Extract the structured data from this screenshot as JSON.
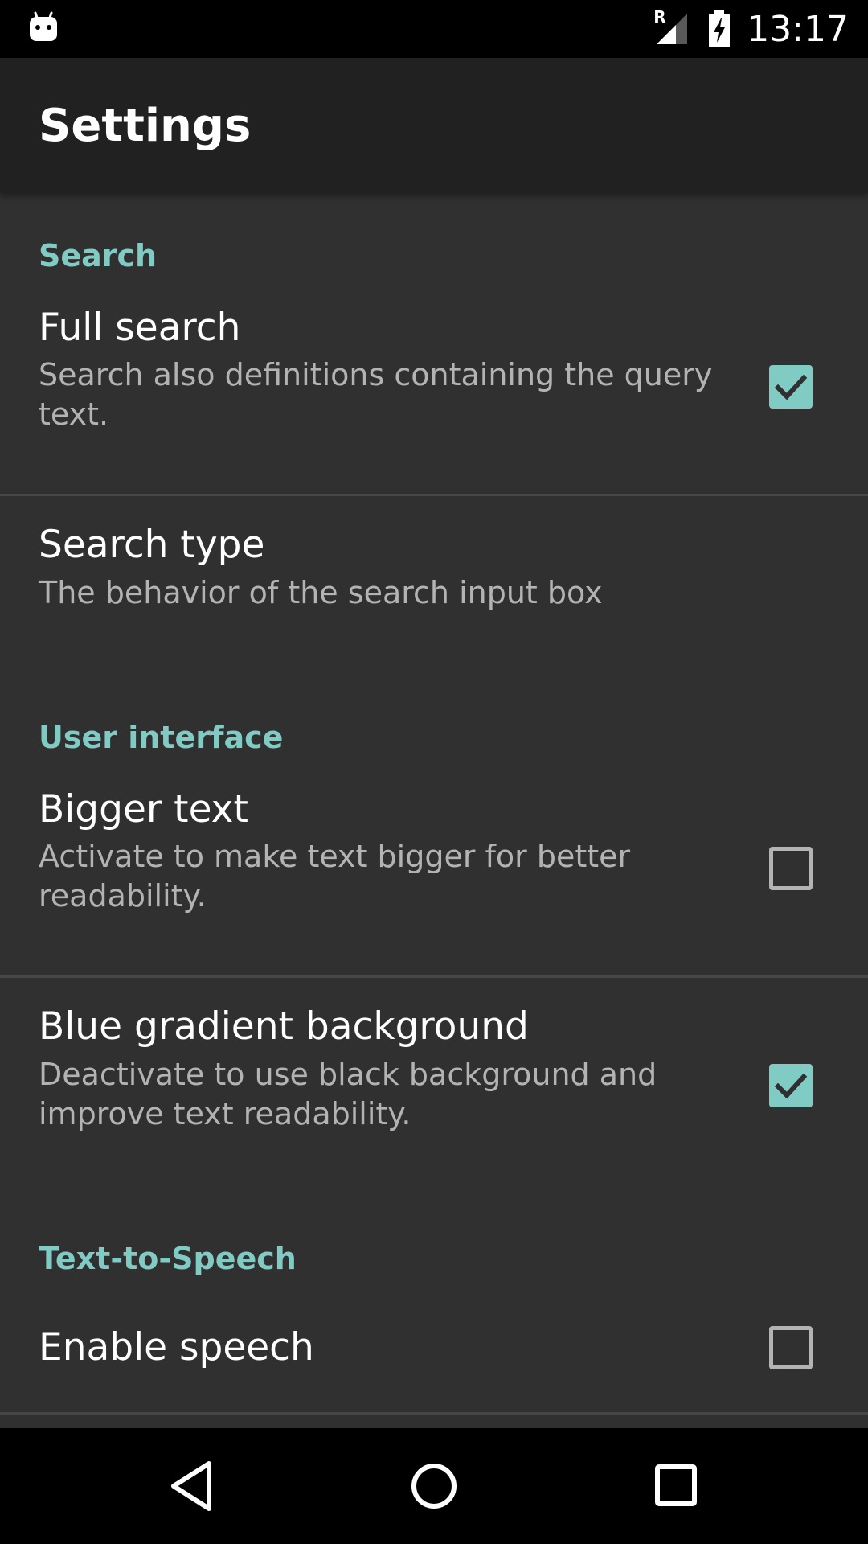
{
  "status_bar": {
    "time": "13:17",
    "roaming_label": "R",
    "icons": [
      "android-notification-icon",
      "signal-roaming-icon",
      "battery-charging-icon"
    ]
  },
  "app_bar": {
    "title": "Settings"
  },
  "categories": {
    "search": "Search",
    "user_interface": "User interface",
    "tts": "Text-to-Speech"
  },
  "prefs": {
    "full_search": {
      "title": "Full search",
      "summary": "Search also definitions containing the query text.",
      "checked": true
    },
    "search_type": {
      "title": "Search type",
      "summary": "The behavior of the search input box"
    },
    "bigger_text": {
      "title": "Bigger text",
      "summary": "Activate to make text bigger for better readability.",
      "checked": false
    },
    "blue_gradient": {
      "title": "Blue gradient background",
      "summary": "Deactivate to use black background and improve text readability.",
      "checked": true
    },
    "enable_speech": {
      "title": "Enable speech",
      "checked": false
    }
  },
  "colors": {
    "accent": "#80cbc4",
    "background": "#303030",
    "app_bar": "#212121",
    "divider": "#474747",
    "summary_text": "#b3b3b3"
  },
  "nav_bar": {
    "icons": [
      "back-icon",
      "home-icon",
      "recents-icon"
    ]
  }
}
